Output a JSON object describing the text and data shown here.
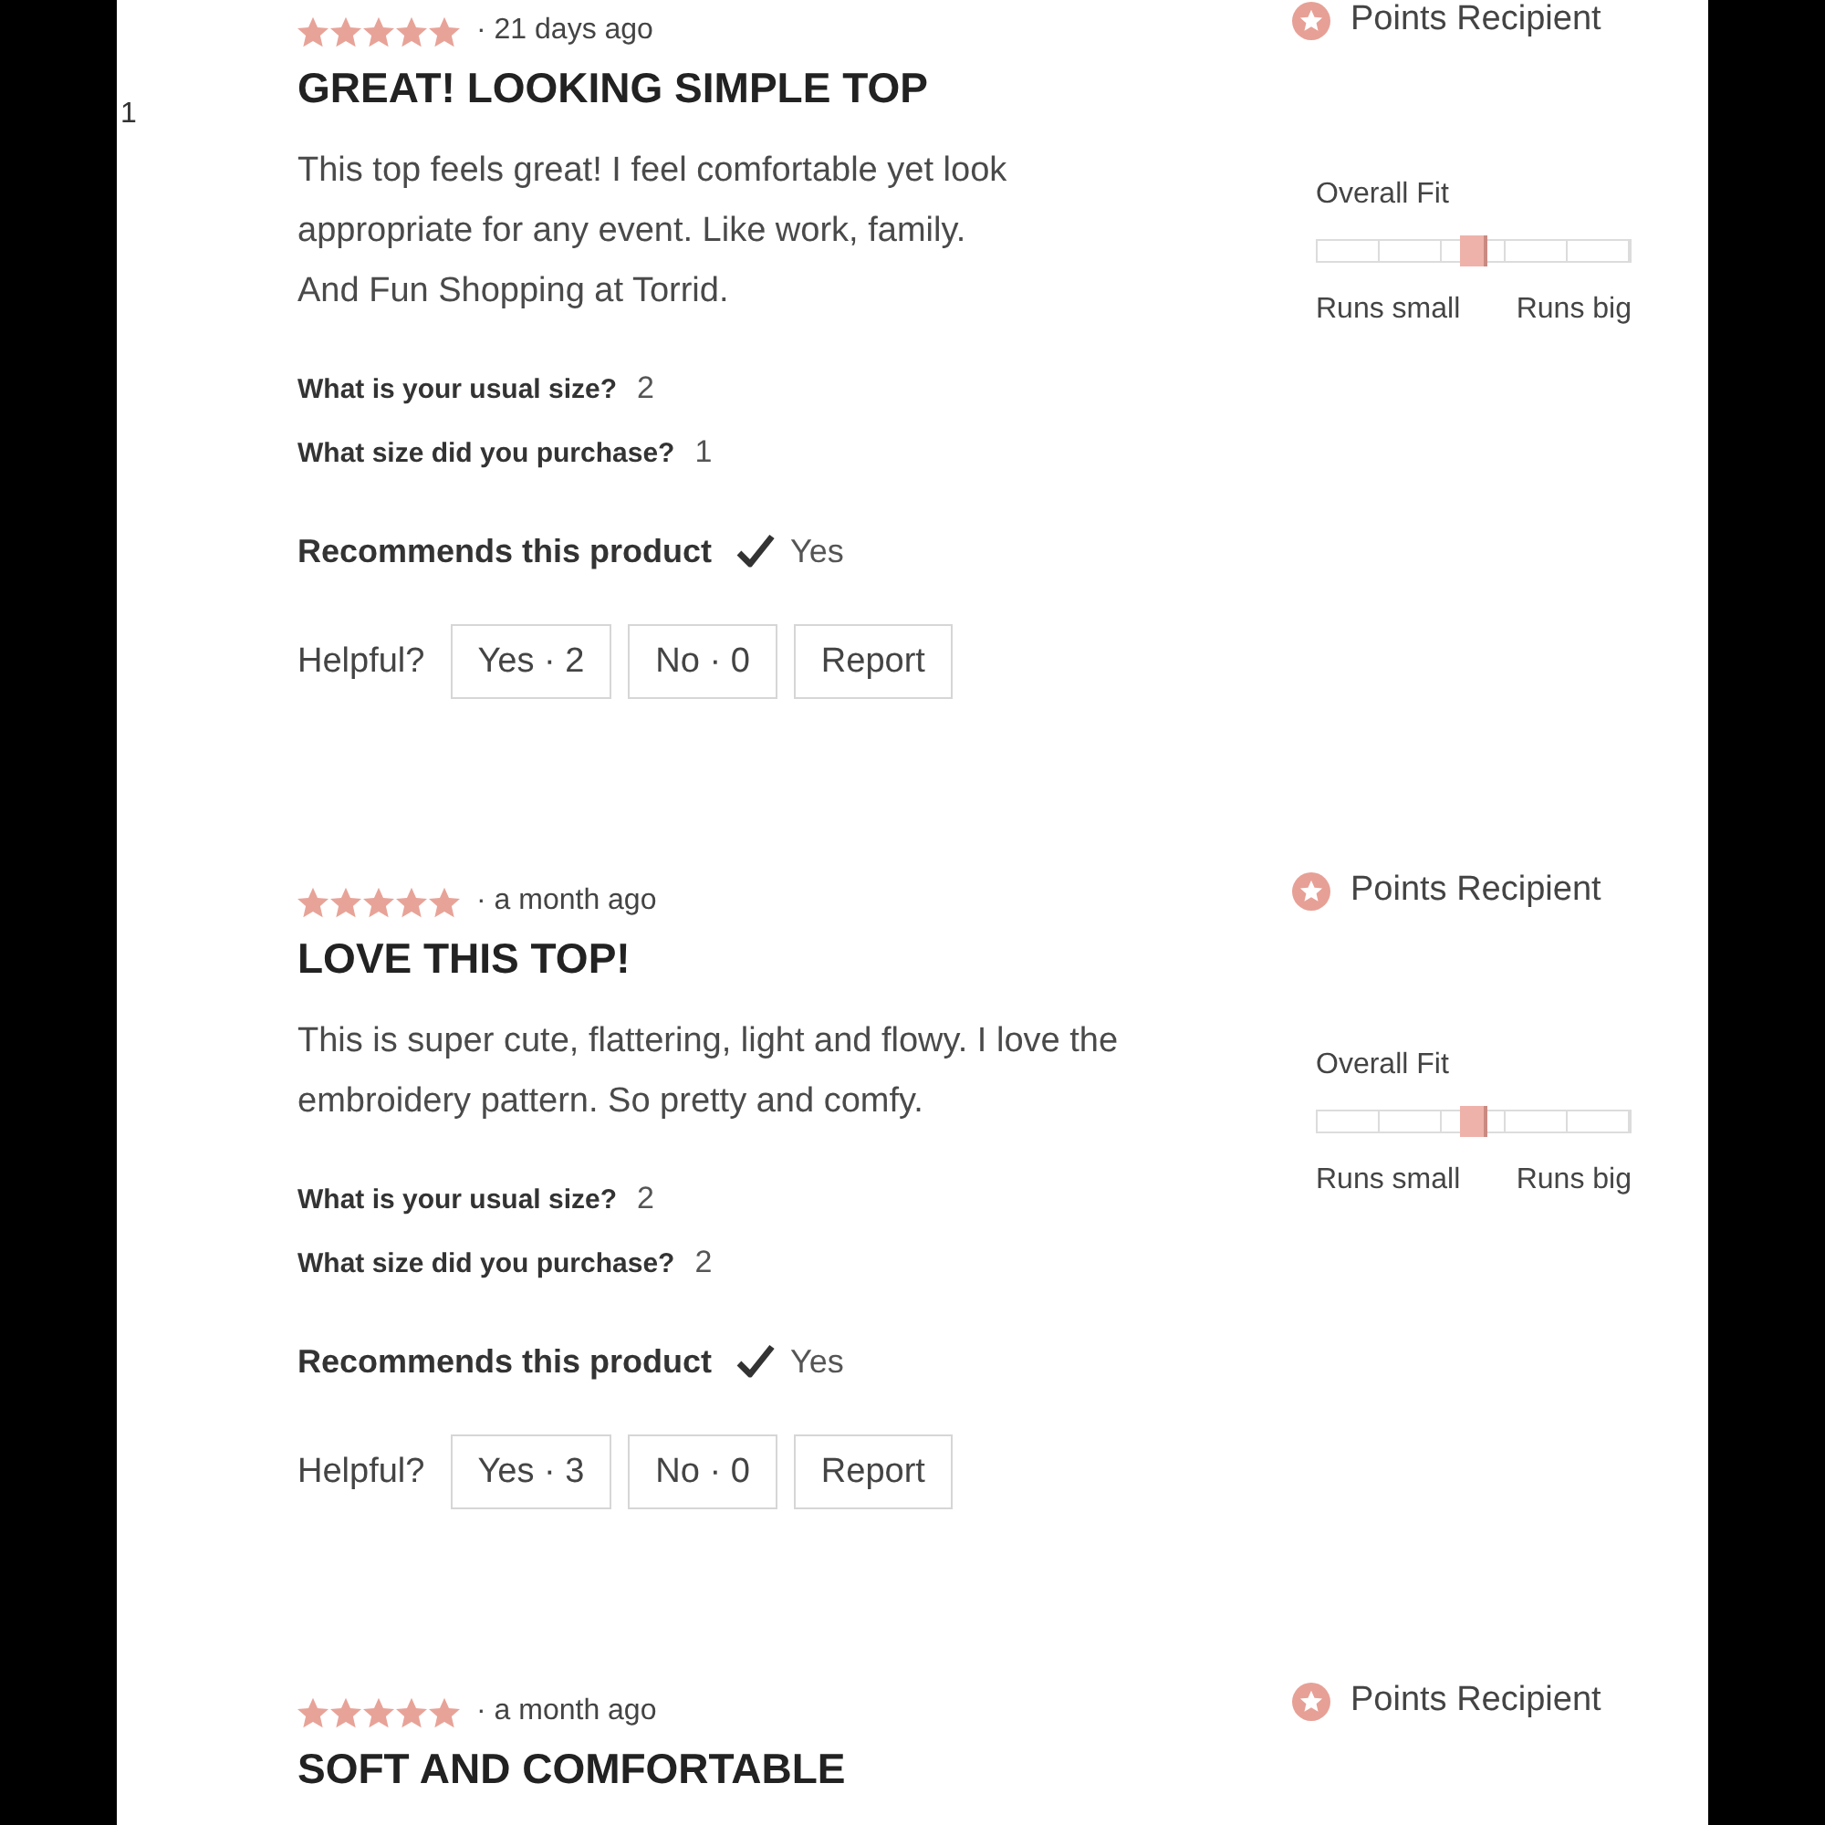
{
  "side_text": "1",
  "reviews": [
    {
      "stars": 5,
      "age": "· 21 days ago",
      "title": "GREAT! LOOKING SIMPLE TOP",
      "body": "This top feels great! I feel comfortable yet look appropriate for any event. Like work, family.\nAnd Fun Shopping at Torrid.",
      "badge": "Points Recipient",
      "fit": {
        "label": "Overall Fit",
        "level": 0.5,
        "low_label": "Runs small",
        "high_label": "Runs big"
      },
      "questions": [
        {
          "label": "What is your usual size?",
          "answer": "2"
        },
        {
          "label": "What size did you purchase?",
          "answer": "1"
        }
      ],
      "recommend": {
        "label": "Recommends this product",
        "recommended": true,
        "answer": "Yes"
      },
      "helpful": {
        "label": "Helpful?",
        "buttons": [
          "Yes · 2",
          "No · 0",
          "Report"
        ]
      }
    },
    {
      "stars": 5,
      "age": "· a month ago",
      "title": "LOVE THIS TOP!",
      "body": "This is super cute, flattering, light and flowy. I love the embroidery pattern. So pretty and comfy.",
      "badge": "Points Recipient",
      "fit": {
        "label": "Overall Fit",
        "level": 0.5,
        "low_label": "Runs small",
        "high_label": "Runs big"
      },
      "questions": [
        {
          "label": "What is your usual size?",
          "answer": "2"
        },
        {
          "label": "What size did you purchase?",
          "answer": "2"
        }
      ],
      "recommend": {
        "label": "Recommends this product",
        "recommended": true,
        "answer": "Yes"
      },
      "helpful": {
        "label": "Helpful?",
        "buttons": [
          "Yes · 3",
          "No · 0",
          "Report"
        ]
      }
    },
    {
      "stars": 5,
      "age": "· a month ago",
      "title": "SOFT AND COMFORTABLE",
      "badge": "Points Recipient"
    }
  ]
}
